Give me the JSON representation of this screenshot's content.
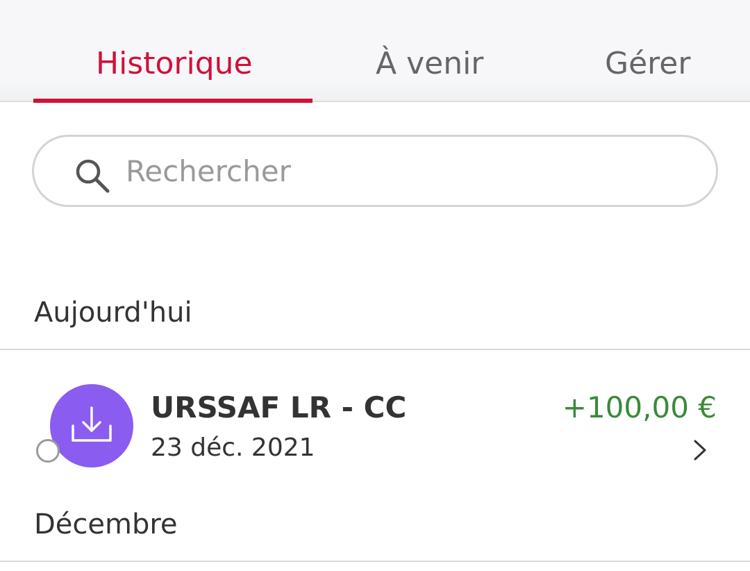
{
  "tabs": [
    {
      "label": "Historique",
      "active": true
    },
    {
      "label": "À venir",
      "active": false
    },
    {
      "label": "Gérer",
      "active": false
    }
  ],
  "search": {
    "placeholder": "Rechercher",
    "value": "",
    "icon": "search-icon"
  },
  "sections": [
    {
      "title": "Aujourd'hui",
      "transactions": [
        {
          "name": "URSSAF LR - CC",
          "date": "23 déc. 2021",
          "amount": "+100,00 €",
          "icon": "download-icon",
          "status": "pending"
        }
      ]
    },
    {
      "title": "Décembre",
      "transactions": []
    }
  ],
  "colors": {
    "accent": "#d0103a",
    "positive_amount": "#3a8a3a",
    "avatar": "#8a5cf0",
    "tab_inactive": "#666666"
  }
}
